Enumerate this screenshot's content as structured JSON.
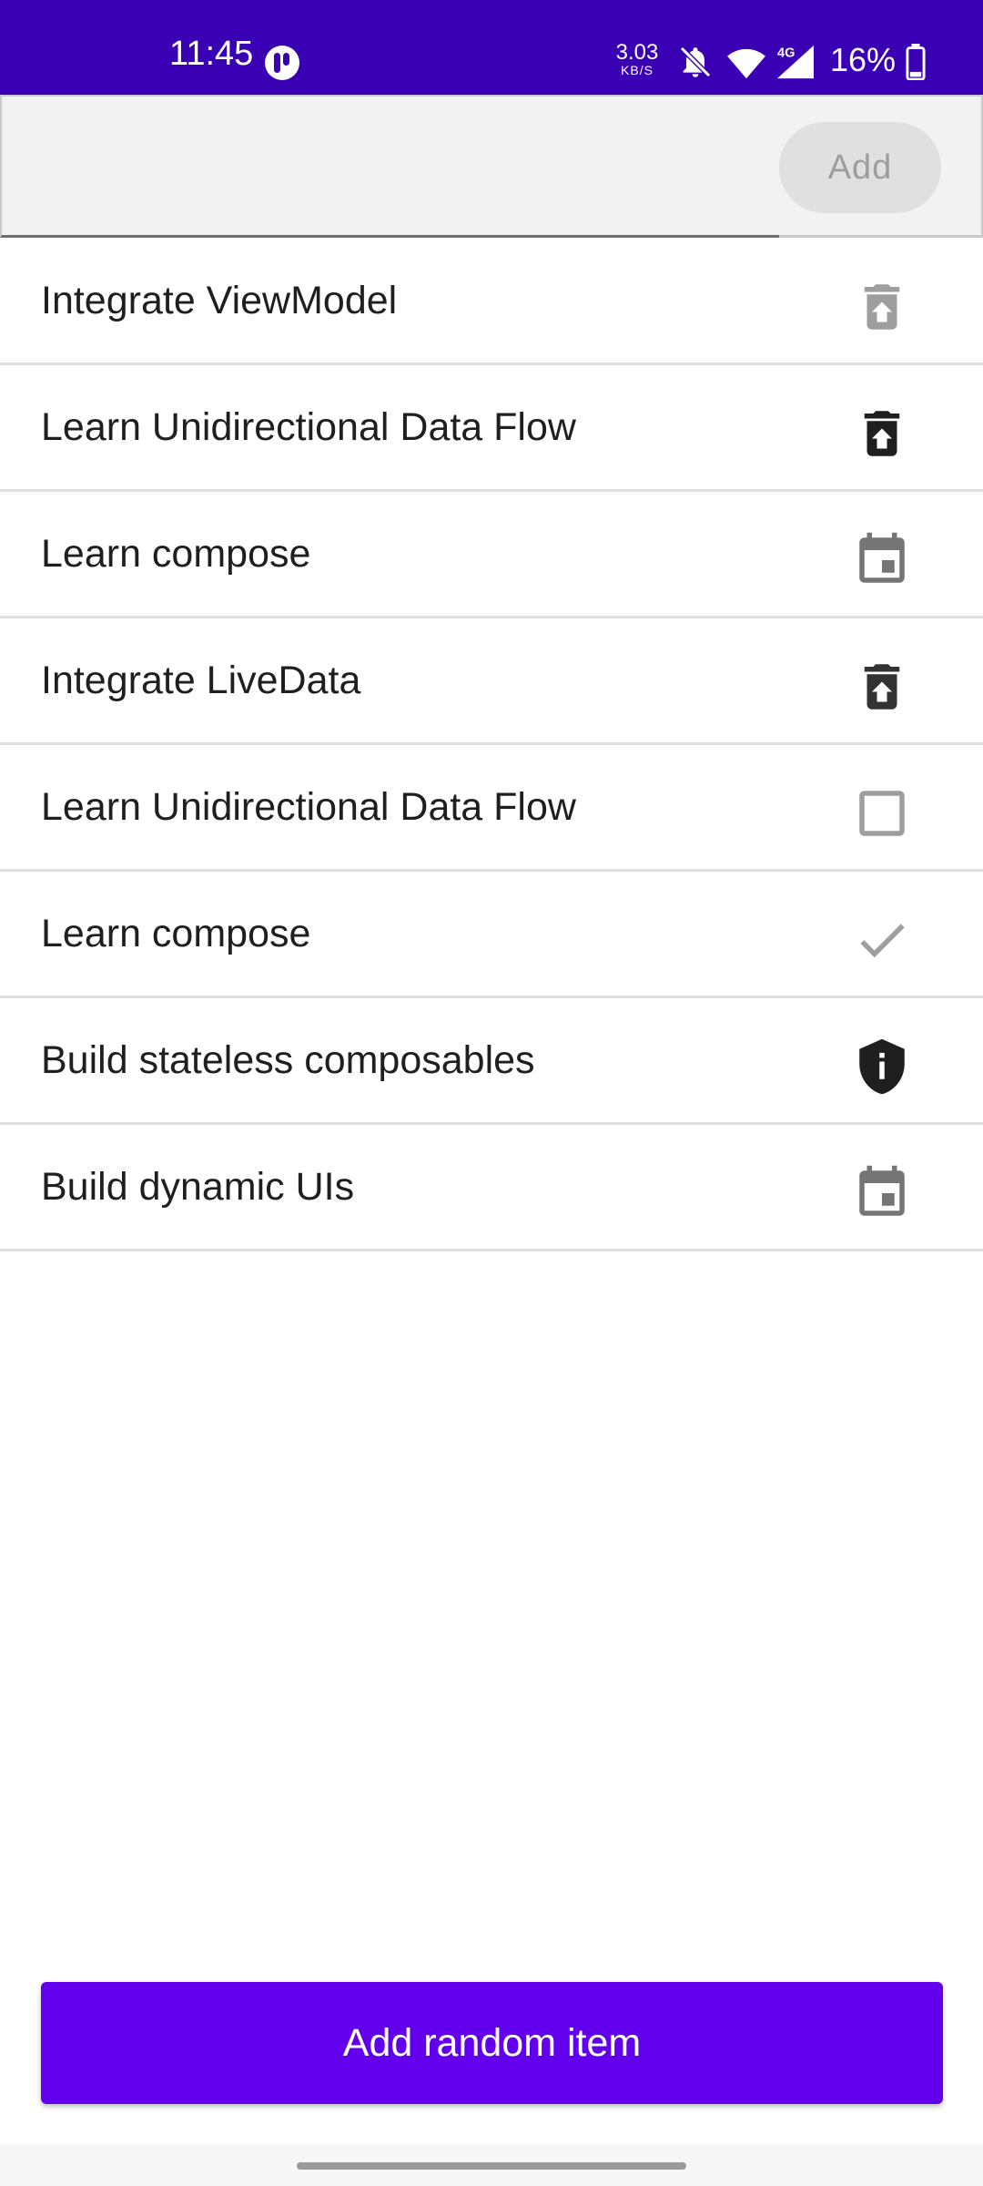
{
  "status_bar": {
    "time": "11:45",
    "net_speed_value": "3.03",
    "net_speed_unit": "KB/S",
    "network_type": "4G",
    "battery_percent": "16%",
    "background_color": "#3a00b3",
    "icons": [
      "app-notification-icon",
      "bell-off-icon",
      "wifi-icon",
      "cellular-signal-icon",
      "battery-icon"
    ]
  },
  "input": {
    "value": "",
    "placeholder": "",
    "add_label": "Add"
  },
  "todo_items": [
    {
      "label": "Integrate ViewModel",
      "icon": "delete-restore-icon",
      "icon_color": "#9e9e9e"
    },
    {
      "label": "Learn Unidirectional Data Flow",
      "icon": "delete-restore-icon",
      "icon_color": "#1f1f1f"
    },
    {
      "label": "Learn compose",
      "icon": "calendar-event-icon",
      "icon_color": "#757575"
    },
    {
      "label": "Integrate LiveData",
      "icon": "delete-restore-icon",
      "icon_color": "#333333"
    },
    {
      "label": "Learn Unidirectional Data Flow",
      "icon": "checkbox-empty-icon",
      "icon_color": "#9e9e9e"
    },
    {
      "label": "Learn compose",
      "icon": "check-icon",
      "icon_color": "#9e9e9e"
    },
    {
      "label": "Build stateless composables",
      "icon": "shield-info-icon",
      "icon_color": "#1f1f1f"
    },
    {
      "label": "Build dynamic UIs",
      "icon": "calendar-event-icon",
      "icon_color": "#757575"
    }
  ],
  "random_button": {
    "label": "Add random item",
    "color": "#6200ee"
  }
}
